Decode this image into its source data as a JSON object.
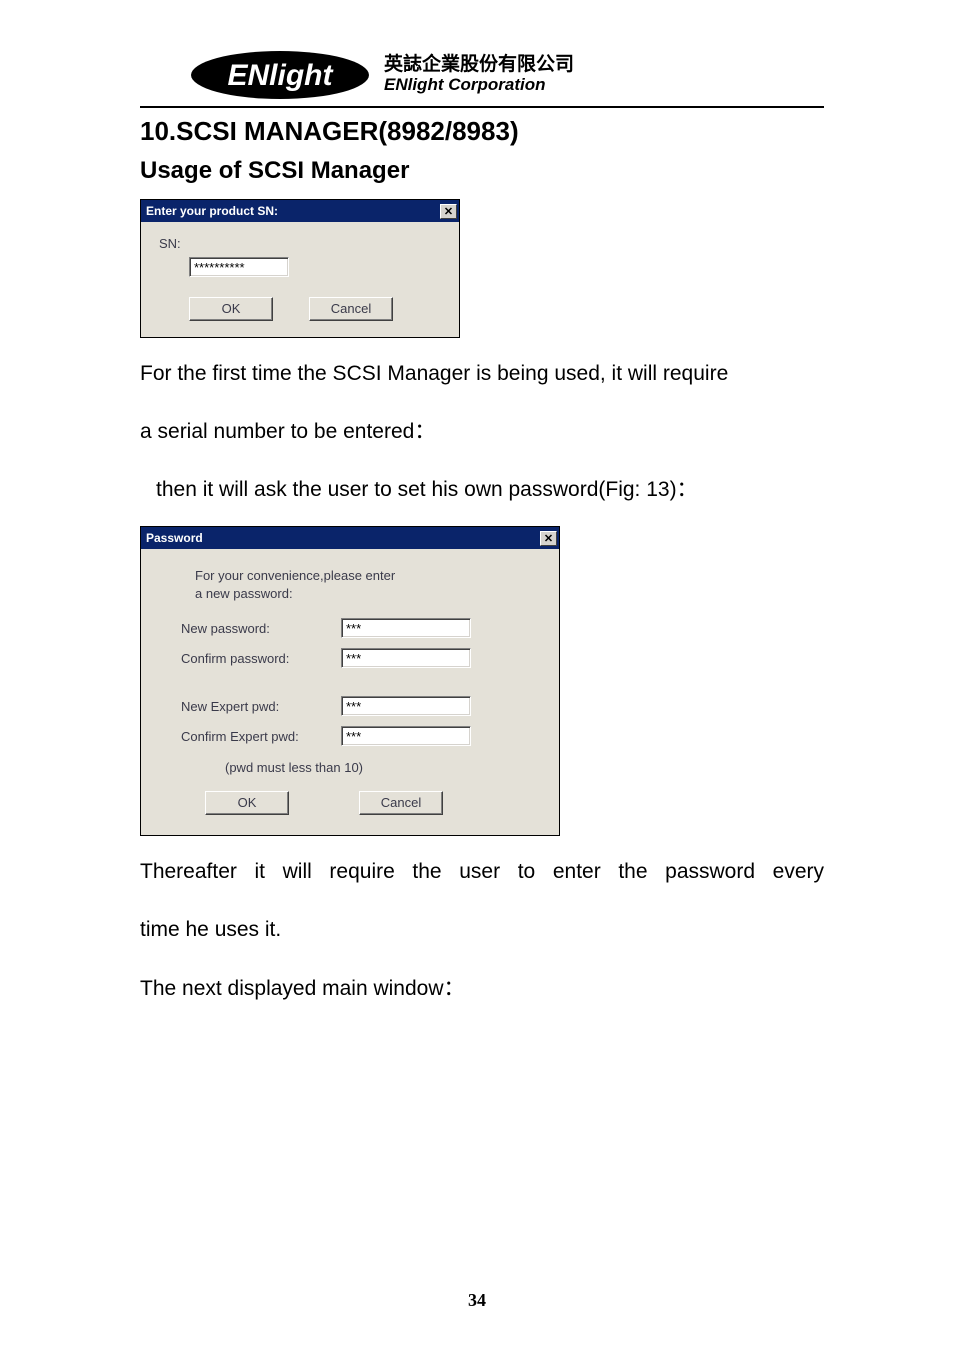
{
  "logo": {
    "cn": "英誌企業股份有限公司",
    "en": "ENlight Corporation"
  },
  "section_title": "10.SCSI MANAGER(8982/8983)",
  "sub_title": "Usage of SCSI Manager",
  "dialog1": {
    "title": "Enter your product SN:",
    "sn_label": "SN:",
    "sn_value": "**********",
    "ok": "OK",
    "cancel": "Cancel"
  },
  "para1": "For the first time the SCSI Manager is being used, it will require",
  "para1b": "a serial number to be entered：",
  "para2": "then it will ask the user to set his own password(Fig: 13)：",
  "dialog2": {
    "title": "Password",
    "intro1": "For your convenience,please enter",
    "intro2": "a new password:",
    "new_pwd_label": "New password:",
    "new_pwd_value": "***",
    "confirm_pwd_label": "Confirm password:",
    "confirm_pwd_value": "***",
    "new_expert_label": "New Expert pwd:",
    "new_expert_value": "***",
    "confirm_expert_label": "Confirm Expert pwd:",
    "confirm_expert_value": "***",
    "hint": "(pwd must less than 10)",
    "ok": "OK",
    "cancel": "Cancel"
  },
  "para3a": "Thereafter it will require the user to enter the password every",
  "para3b": "time he uses it.",
  "para4": "The next displayed main window：",
  "page_number": "34"
}
